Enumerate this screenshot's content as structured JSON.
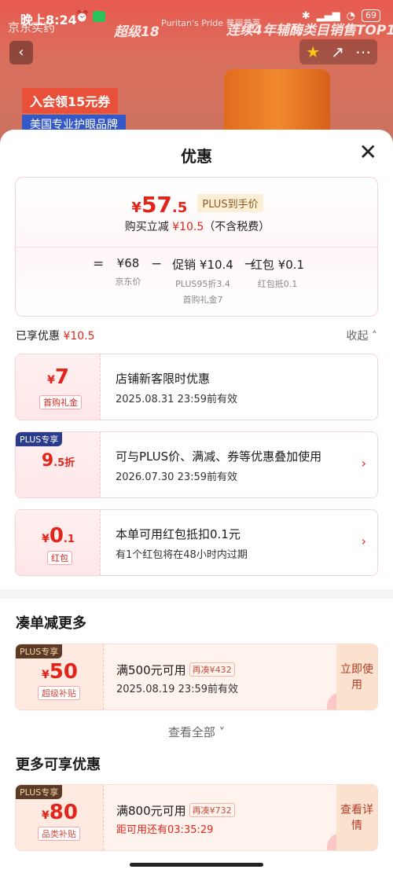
{
  "status_bar": {
    "time": "晚上8:24",
    "battery": "69"
  },
  "banner": {
    "store": "京东买药",
    "event": "超级18",
    "brand": "Puritan's Pride 普丽普莱",
    "slogan": "连续4年辅酶类目销售TOP1",
    "promo_coupon": "入会领15元券",
    "promo_brand": "美国专业护眼品牌"
  },
  "sheet": {
    "title": "优惠",
    "summary": {
      "price_symbol": "¥",
      "price_int": "57",
      "price_dec": ".5",
      "plus_tag": "PLUS到手价",
      "direct_text": "购买立减",
      "direct_amount": "¥10.5",
      "direct_note": "（不含税费）",
      "formula": {
        "eq": "=",
        "jd_price": "¥68",
        "jd_label": "京东价",
        "minus1": "−",
        "promo": "促销 ¥10.4",
        "promo_sub1": "PLUS95折3.4",
        "promo_sub2": "首购礼金7",
        "minus2": "−",
        "redpack": "红包 ¥0.1",
        "redpack_sub": "红包抵0.1"
      }
    },
    "enjoyed_label": "已享优惠",
    "enjoyed_amount": "¥10.5",
    "collapse_label": "收起",
    "discounts": [
      {
        "symbol": "¥",
        "amount": "7",
        "suffix": "",
        "tag": "首购礼金",
        "badge": "",
        "title": "店铺新客限时优惠",
        "desc": "2025.08.31 23:59前有效"
      },
      {
        "symbol": "",
        "amount": "9",
        "suffix": ".5折",
        "tag": "",
        "badge": "PLUS专享",
        "title": "可与PLUS价、满减、券等优惠叠加使用",
        "desc": "2026.07.30 23:59前有效"
      },
      {
        "symbol": "¥",
        "amount": "0",
        "suffix": ".1",
        "tag": "红包",
        "badge": "",
        "title": "本单可用红包抵扣0.1元",
        "desc": "有1个红包将在48小时内过期"
      }
    ],
    "more_title": "凑单减更多",
    "coupon1": {
      "badge": "PLUS专享",
      "symbol": "¥",
      "amount": "50",
      "tag": "超级补贴",
      "title": "满500元可用",
      "need": "再凑¥432",
      "desc": "2025.08.19 23:59前有效",
      "action": "立即使用"
    },
    "view_all": "查看全部",
    "more2_title": "更多可享优惠",
    "coupon2": {
      "badge": "PLUS专享",
      "symbol": "¥",
      "amount": "80",
      "tag": "品类补贴",
      "title": "满800元可用",
      "need": "再凑¥732",
      "desc": "距可用还有03:35:29",
      "action": "查看详情"
    }
  }
}
